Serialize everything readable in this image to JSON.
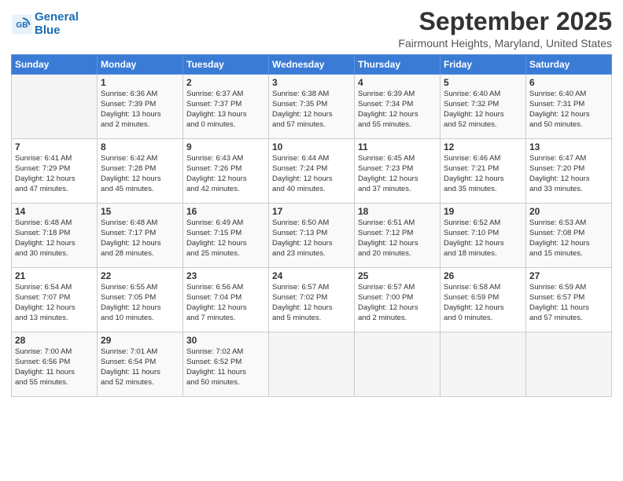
{
  "header": {
    "logo_line1": "General",
    "logo_line2": "Blue",
    "month": "September 2025",
    "location": "Fairmount Heights, Maryland, United States"
  },
  "weekdays": [
    "Sunday",
    "Monday",
    "Tuesday",
    "Wednesday",
    "Thursday",
    "Friday",
    "Saturday"
  ],
  "weeks": [
    [
      {
        "day": "",
        "info": ""
      },
      {
        "day": "1",
        "info": "Sunrise: 6:36 AM\nSunset: 7:39 PM\nDaylight: 13 hours\nand 2 minutes."
      },
      {
        "day": "2",
        "info": "Sunrise: 6:37 AM\nSunset: 7:37 PM\nDaylight: 13 hours\nand 0 minutes."
      },
      {
        "day": "3",
        "info": "Sunrise: 6:38 AM\nSunset: 7:35 PM\nDaylight: 12 hours\nand 57 minutes."
      },
      {
        "day": "4",
        "info": "Sunrise: 6:39 AM\nSunset: 7:34 PM\nDaylight: 12 hours\nand 55 minutes."
      },
      {
        "day": "5",
        "info": "Sunrise: 6:40 AM\nSunset: 7:32 PM\nDaylight: 12 hours\nand 52 minutes."
      },
      {
        "day": "6",
        "info": "Sunrise: 6:40 AM\nSunset: 7:31 PM\nDaylight: 12 hours\nand 50 minutes."
      }
    ],
    [
      {
        "day": "7",
        "info": "Sunrise: 6:41 AM\nSunset: 7:29 PM\nDaylight: 12 hours\nand 47 minutes."
      },
      {
        "day": "8",
        "info": "Sunrise: 6:42 AM\nSunset: 7:28 PM\nDaylight: 12 hours\nand 45 minutes."
      },
      {
        "day": "9",
        "info": "Sunrise: 6:43 AM\nSunset: 7:26 PM\nDaylight: 12 hours\nand 42 minutes."
      },
      {
        "day": "10",
        "info": "Sunrise: 6:44 AM\nSunset: 7:24 PM\nDaylight: 12 hours\nand 40 minutes."
      },
      {
        "day": "11",
        "info": "Sunrise: 6:45 AM\nSunset: 7:23 PM\nDaylight: 12 hours\nand 37 minutes."
      },
      {
        "day": "12",
        "info": "Sunrise: 6:46 AM\nSunset: 7:21 PM\nDaylight: 12 hours\nand 35 minutes."
      },
      {
        "day": "13",
        "info": "Sunrise: 6:47 AM\nSunset: 7:20 PM\nDaylight: 12 hours\nand 33 minutes."
      }
    ],
    [
      {
        "day": "14",
        "info": "Sunrise: 6:48 AM\nSunset: 7:18 PM\nDaylight: 12 hours\nand 30 minutes."
      },
      {
        "day": "15",
        "info": "Sunrise: 6:48 AM\nSunset: 7:17 PM\nDaylight: 12 hours\nand 28 minutes."
      },
      {
        "day": "16",
        "info": "Sunrise: 6:49 AM\nSunset: 7:15 PM\nDaylight: 12 hours\nand 25 minutes."
      },
      {
        "day": "17",
        "info": "Sunrise: 6:50 AM\nSunset: 7:13 PM\nDaylight: 12 hours\nand 23 minutes."
      },
      {
        "day": "18",
        "info": "Sunrise: 6:51 AM\nSunset: 7:12 PM\nDaylight: 12 hours\nand 20 minutes."
      },
      {
        "day": "19",
        "info": "Sunrise: 6:52 AM\nSunset: 7:10 PM\nDaylight: 12 hours\nand 18 minutes."
      },
      {
        "day": "20",
        "info": "Sunrise: 6:53 AM\nSunset: 7:08 PM\nDaylight: 12 hours\nand 15 minutes."
      }
    ],
    [
      {
        "day": "21",
        "info": "Sunrise: 6:54 AM\nSunset: 7:07 PM\nDaylight: 12 hours\nand 13 minutes."
      },
      {
        "day": "22",
        "info": "Sunrise: 6:55 AM\nSunset: 7:05 PM\nDaylight: 12 hours\nand 10 minutes."
      },
      {
        "day": "23",
        "info": "Sunrise: 6:56 AM\nSunset: 7:04 PM\nDaylight: 12 hours\nand 7 minutes."
      },
      {
        "day": "24",
        "info": "Sunrise: 6:57 AM\nSunset: 7:02 PM\nDaylight: 12 hours\nand 5 minutes."
      },
      {
        "day": "25",
        "info": "Sunrise: 6:57 AM\nSunset: 7:00 PM\nDaylight: 12 hours\nand 2 minutes."
      },
      {
        "day": "26",
        "info": "Sunrise: 6:58 AM\nSunset: 6:59 PM\nDaylight: 12 hours\nand 0 minutes."
      },
      {
        "day": "27",
        "info": "Sunrise: 6:59 AM\nSunset: 6:57 PM\nDaylight: 11 hours\nand 57 minutes."
      }
    ],
    [
      {
        "day": "28",
        "info": "Sunrise: 7:00 AM\nSunset: 6:56 PM\nDaylight: 11 hours\nand 55 minutes."
      },
      {
        "day": "29",
        "info": "Sunrise: 7:01 AM\nSunset: 6:54 PM\nDaylight: 11 hours\nand 52 minutes."
      },
      {
        "day": "30",
        "info": "Sunrise: 7:02 AM\nSunset: 6:52 PM\nDaylight: 11 hours\nand 50 minutes."
      },
      {
        "day": "",
        "info": ""
      },
      {
        "day": "",
        "info": ""
      },
      {
        "day": "",
        "info": ""
      },
      {
        "day": "",
        "info": ""
      }
    ]
  ]
}
